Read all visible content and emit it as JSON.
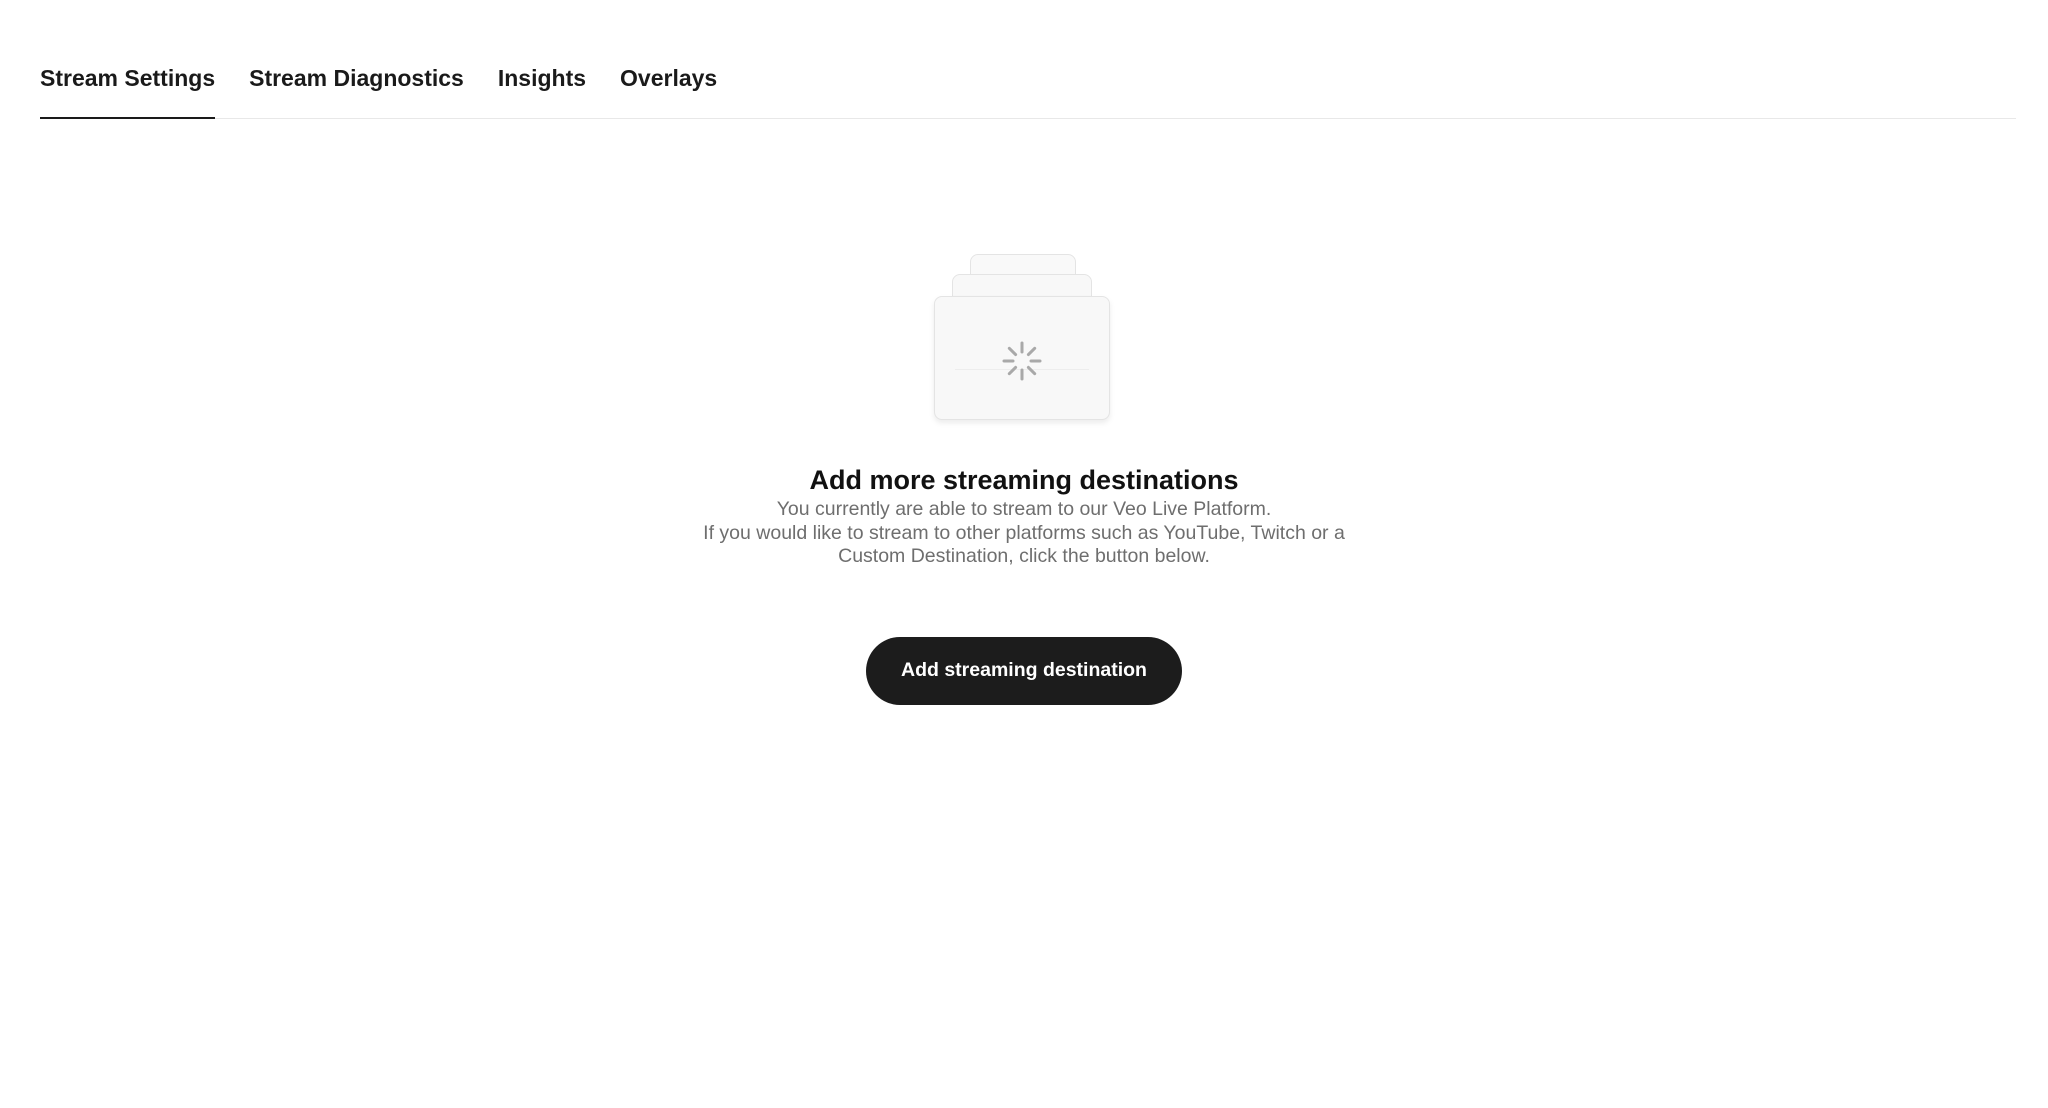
{
  "tabs": [
    {
      "label": "Stream Settings",
      "active": true
    },
    {
      "label": "Stream Diagnostics",
      "active": false
    },
    {
      "label": "Insights",
      "active": false
    },
    {
      "label": "Overlays",
      "active": false
    }
  ],
  "empty_state": {
    "illustration_icon": "loading-spinner-icon",
    "title": "Add more streaming destinations",
    "line1": "You currently are able to stream to our Veo Live Platform.",
    "line2": "If you would like to stream to other platforms such as YouTube, Twitch or a Custom Destination, click the button below.",
    "button_label": "Add streaming destination"
  },
  "colors": {
    "text_primary": "#1a1a1a",
    "text_secondary": "#6e6e6e",
    "button_bg": "#1c1c1c",
    "button_text": "#ffffff",
    "divider": "#e8e8e8"
  }
}
